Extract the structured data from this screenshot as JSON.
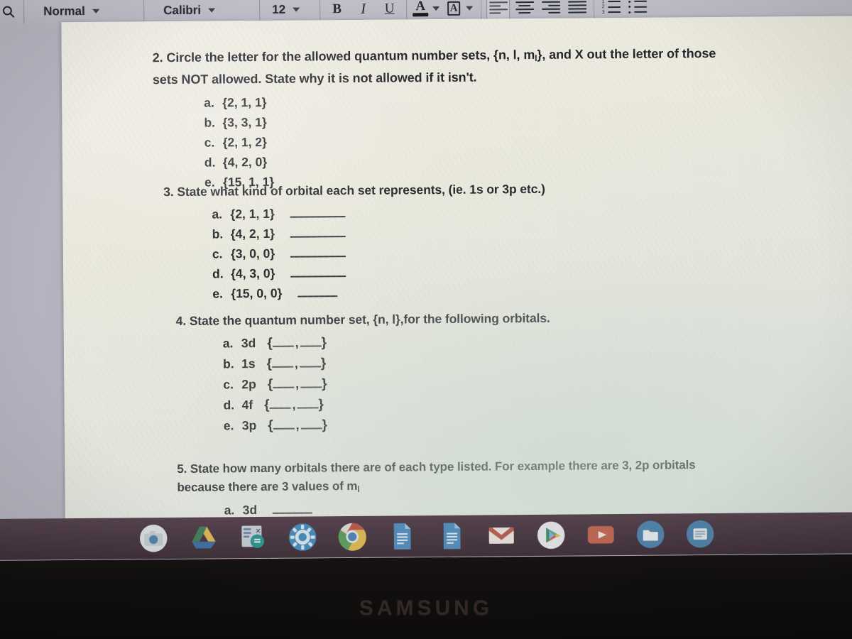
{
  "toolbar": {
    "search_icon": "search-icon",
    "paragraph_style": "Normal",
    "font_family": "Calibri",
    "font_size": "12",
    "bold_label": "B",
    "italic_label": "I",
    "underline_label": "U",
    "text_color_label": "A",
    "text_color_swatch": "#1a1a1a",
    "highlight_color_label": "A",
    "highlight_color_swatch": "#1a1a1a",
    "align_left_label": "align-left",
    "align_center_label": "align-center",
    "align_right_label": "align-right",
    "align_justify_label": "align-justify",
    "numbered_list_label": "numbered-list",
    "bulleted_list_label": "bulleted-list",
    "active_alignment": "align-left"
  },
  "document": {
    "questions": [
      {
        "id": "q2",
        "number": "2.",
        "heading_line_1": "Circle the letter for the allowed quantum number sets, {n, l, m",
        "heading_sub": "l",
        "heading_line_1_end": "}, and X out the letter of those",
        "heading_line_2": "sets NOT allowed.  State why it is not allowed if it isn't.",
        "items": [
          {
            "letter": "a.",
            "value": "{2, 1, 1}"
          },
          {
            "letter": "b.",
            "value": "{3, 3, 1}"
          },
          {
            "letter": "c.",
            "value": "{2, 1, 2}"
          },
          {
            "letter": "d.",
            "value": "{4, 2, 0}"
          },
          {
            "letter": "e.",
            "value": "{15, 1, 1}"
          }
        ]
      },
      {
        "id": "q3",
        "number": "3.",
        "heading": "State what kind of orbital each set represents, (ie. 1s or 3p etc.)",
        "items": [
          {
            "letter": "a.",
            "value": "{2, 1, 1}"
          },
          {
            "letter": "b.",
            "value": "{4, 2, 1}"
          },
          {
            "letter": "c.",
            "value": "{3, 0, 0}"
          },
          {
            "letter": "d.",
            "value": "{4, 3, 0}"
          },
          {
            "letter": "e.",
            "value": "{15, 0, 0}"
          }
        ]
      },
      {
        "id": "q4",
        "number": "4.",
        "heading_start": "State the quantum number set, {n, l},for the following orbitals.",
        "items": [
          {
            "letter": "a.",
            "value": "3d"
          },
          {
            "letter": "b.",
            "value": "1s"
          },
          {
            "letter": "c.",
            "value": "2p"
          },
          {
            "letter": "d.",
            "value": "4f"
          },
          {
            "letter": "e.",
            "value": "3p"
          }
        ],
        "brace_open": "{",
        "brace_close": "}",
        "brace_comma": ","
      },
      {
        "id": "q5",
        "number": "5.",
        "heading_line_1": "State how many orbitals there are of each type listed.  For example there are 3, 2p orbitals",
        "heading_line_2_pre": "because there are 3 values of m",
        "heading_line_2_sub": "l",
        "items": [
          {
            "letter": "a.",
            "value": "3d"
          }
        ]
      }
    ]
  },
  "taskbar": {
    "apps": [
      {
        "name": "camera-icon",
        "label": "Camera"
      },
      {
        "name": "google-drive-icon",
        "label": "Drive"
      },
      {
        "name": "google-sheets-icon",
        "label": "Sheets"
      },
      {
        "name": "settings-gear-icon",
        "label": "Settings"
      },
      {
        "name": "google-chrome-icon",
        "label": "Chrome"
      },
      {
        "name": "google-docs-icon",
        "label": "Docs"
      },
      {
        "name": "google-docs-icon-2",
        "label": "Docs"
      },
      {
        "name": "gmail-icon",
        "label": "Gmail"
      },
      {
        "name": "play-store-icon",
        "label": "Play Store"
      },
      {
        "name": "youtube-icon",
        "label": "YouTube"
      },
      {
        "name": "files-icon",
        "label": "Files"
      },
      {
        "name": "keep-notes-icon",
        "label": "Keep"
      }
    ]
  },
  "monitor": {
    "brand": "SAMSUNG"
  }
}
